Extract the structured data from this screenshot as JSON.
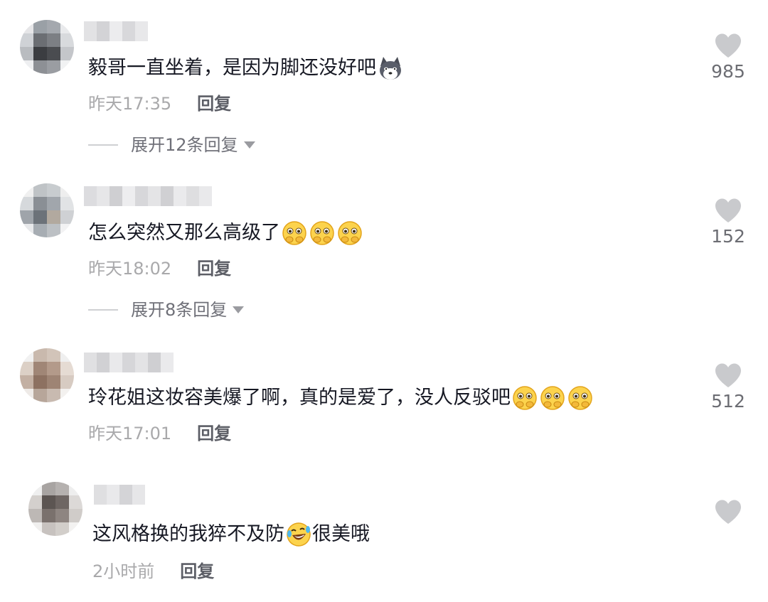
{
  "comments": [
    {
      "text": "毅哥一直坐着，是因为脚还没好吧",
      "emojis": [
        "husky-emoji"
      ],
      "time": "昨天17:35",
      "reply_label": "回复",
      "expand_label": "展开12条回复",
      "likes": "985"
    },
    {
      "text": "怎么突然又那么高级了",
      "emojis": [
        "pleading-emoji",
        "pleading-emoji",
        "pleading-emoji"
      ],
      "time": "昨天18:02",
      "reply_label": "回复",
      "expand_label": "展开8条回复",
      "likes": "152"
    },
    {
      "text": "玲花姐这妆容美爆了啊，真的是爱了，没人反驳吧",
      "emojis": [
        "pleading-emoji",
        "pleading-emoji",
        "pleading-emoji"
      ],
      "time": "昨天17:01",
      "reply_label": "回复",
      "likes": "512"
    },
    {
      "text_before": "这风格换的我猝不及防",
      "text_after": "很美哦",
      "emojis": [
        "laughing-crying-emoji"
      ],
      "time": "2小时前",
      "reply_label": "回复",
      "likes": ""
    }
  ],
  "colors": {
    "like_icon": "#c9cacd",
    "time": "#a9a9ab",
    "reply": "#5c5e66",
    "expand": "#6f7078"
  }
}
